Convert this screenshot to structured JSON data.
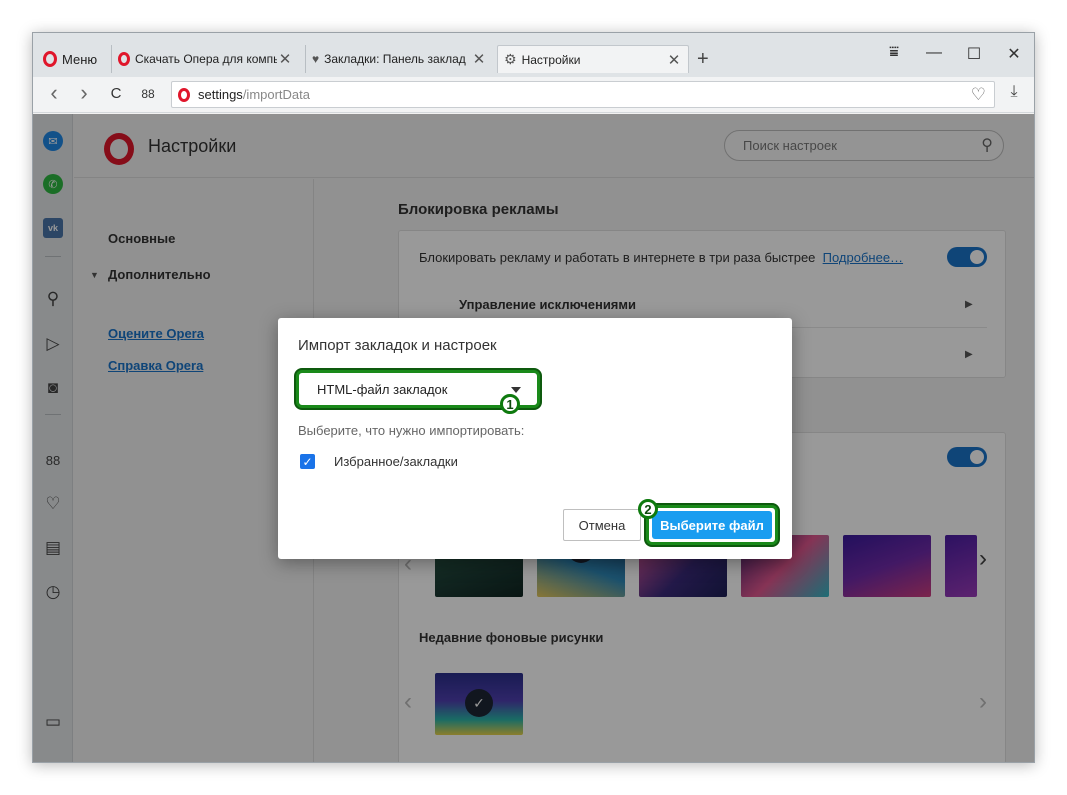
{
  "tabs": {
    "menu_label": "Меню",
    "tab1_title": "Скачать Опера для компь",
    "tab2_title": "Закладки: Панель заклад",
    "tab3_title": "Настройки",
    "new_tab": "+"
  },
  "window_controls": {
    "filter": "⩸",
    "minimize": "—",
    "maximize": "☐",
    "close": "✕"
  },
  "addressbar": {
    "back": "‹",
    "forward": "›",
    "reload": "C",
    "speed_dial": "88",
    "url_host": "settings",
    "url_path": "/importData"
  },
  "settings": {
    "title": "Настройки",
    "search_placeholder": "Поиск настроек",
    "nav_basic": "Основные",
    "nav_advanced": "Дополнительно",
    "nav_rate": "Оцените Opera",
    "nav_help": "Справка Opera"
  },
  "adblock": {
    "section_title": "Блокировка рекламы",
    "description": "Блокировать рекламу и работать в интернете в три раза быстрее",
    "more_link": "Подробнее…",
    "manage_exceptions": "Управление исключениями",
    "recent_wallpapers": "Недавние фоновые рисунки"
  },
  "dialog": {
    "title": "Импорт закладок и настроек",
    "select_value": "HTML-файл закладок",
    "hint": "Выберите, что нужно импортировать:",
    "checkbox_label": "Избранное/закладки",
    "checkbox_checked": true,
    "cancel": "Отмена",
    "choose_file": "Выберите файл",
    "badge_1": "1",
    "badge_2": "2"
  },
  "colors": {
    "opera_red": "#e0162b",
    "accent_blue": "#1a73c9",
    "primary_button": "#1a9df0",
    "highlight_green": "#1a8a1a"
  }
}
